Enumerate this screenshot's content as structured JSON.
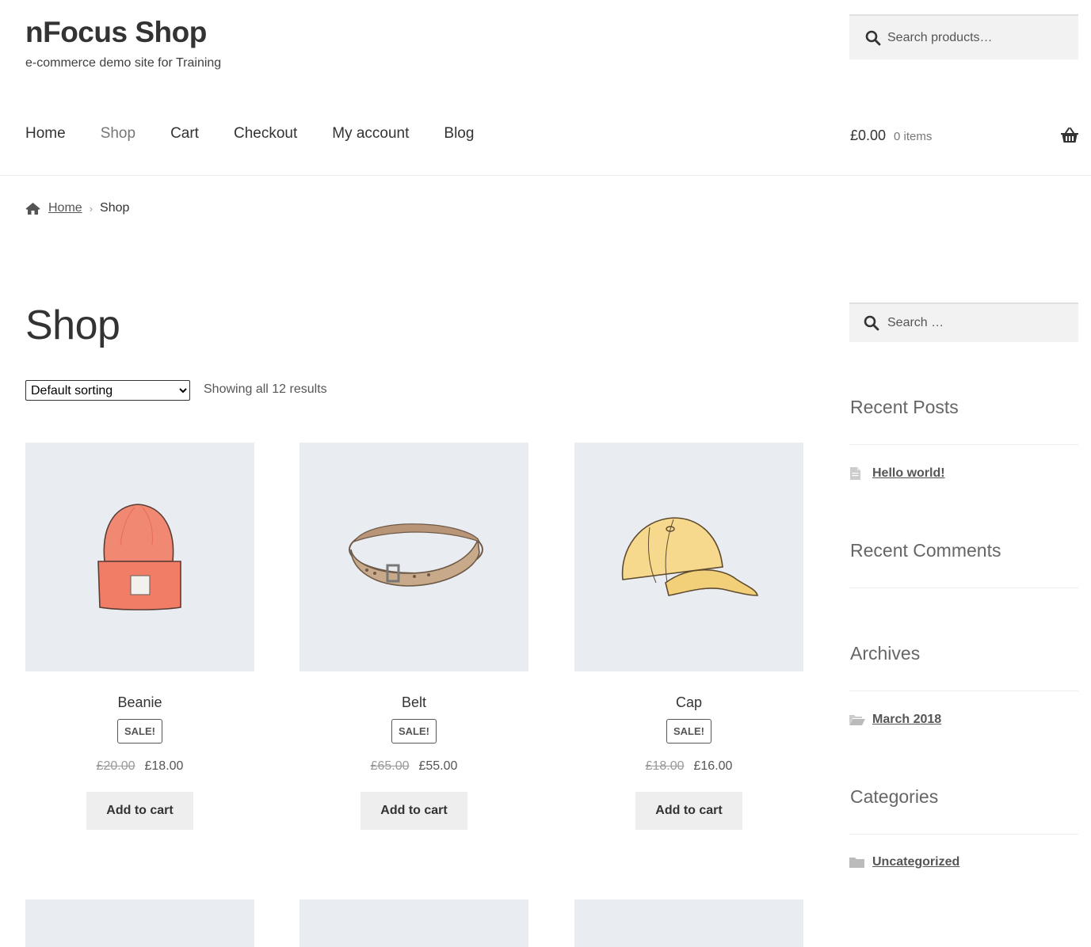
{
  "site": {
    "title": "nFocus Shop",
    "description": "e-commerce demo site for Training"
  },
  "header_search": {
    "placeholder": "Search products…"
  },
  "nav": [
    {
      "label": "Home"
    },
    {
      "label": "Shop",
      "current": true
    },
    {
      "label": "Cart"
    },
    {
      "label": "Checkout"
    },
    {
      "label": "My account"
    },
    {
      "label": "Blog"
    }
  ],
  "cart": {
    "total": "£0.00",
    "count": "0 items"
  },
  "breadcrumb": {
    "home": "Home",
    "current": "Shop"
  },
  "main": {
    "title": "Shop",
    "sort_selected": "Default sorting",
    "result_count": "Showing all 12 results"
  },
  "products": [
    {
      "name": "Beanie",
      "badge": "SALE!",
      "old_price": "£20.00",
      "price": "£18.00",
      "button": "Add to cart",
      "image_icon": "beanie-image"
    },
    {
      "name": "Belt",
      "badge": "SALE!",
      "old_price": "£65.00",
      "price": "£55.00",
      "button": "Add to cart",
      "image_icon": "belt-image"
    },
    {
      "name": "Cap",
      "badge": "SALE!",
      "old_price": "£18.00",
      "price": "£16.00",
      "button": "Add to cart",
      "image_icon": "cap-image"
    }
  ],
  "sidebar": {
    "search_placeholder": "Search …",
    "recent_posts": {
      "title": "Recent Posts",
      "items": [
        "Hello world!"
      ]
    },
    "recent_comments": {
      "title": "Recent Comments"
    },
    "archives": {
      "title": "Archives",
      "items": [
        "March 2018"
      ]
    },
    "categories": {
      "title": "Categories",
      "items": [
        "Uncategorized"
      ]
    }
  },
  "colors": {
    "text": "#333333",
    "muted": "#777777",
    "image_bg": "#e9edf1",
    "button_bg": "#eeeeee"
  }
}
